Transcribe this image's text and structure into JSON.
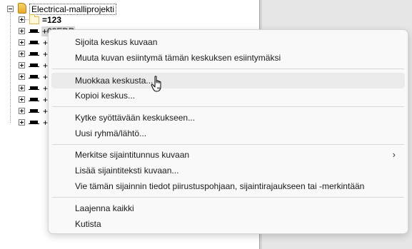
{
  "tree": {
    "root": {
      "label": "Electrical-malliprojekti",
      "icon": "project-icon"
    },
    "folder": {
      "label": "=123",
      "icon": "folder-icon"
    },
    "selected": {
      "label": "+03EDP",
      "icon": "distribution-center-icon"
    },
    "partial_label": "+",
    "center_count": 8
  },
  "menu": {
    "items": [
      {
        "label": "Sijoita keskus kuvaan"
      },
      {
        "label": "Muuta kuvan esiintymä tämän keskuksen esiintymäksi"
      },
      {
        "label": "Muokkaa keskusta..."
      },
      {
        "label": "Kopioi keskus..."
      },
      {
        "label": "Kytke syöttävään keskukseen..."
      },
      {
        "label": "Uusi ryhmä/lähtö..."
      },
      {
        "label": "Merkitse sijaintitunnus kuvaan",
        "submenu_icon": "chevron-right-icon",
        "arrow": "›"
      },
      {
        "label": "Lisää sijaintiteksti kuvaan..."
      },
      {
        "label": "Vie tämän sijainnin tiedot piirustuspohjaan, sijaintirajaukseen tai -merkintään"
      },
      {
        "label": "Laajenna kaikki"
      },
      {
        "label": "Kutista"
      }
    ]
  },
  "cursor": {
    "icon": "hand-pointer-icon"
  }
}
